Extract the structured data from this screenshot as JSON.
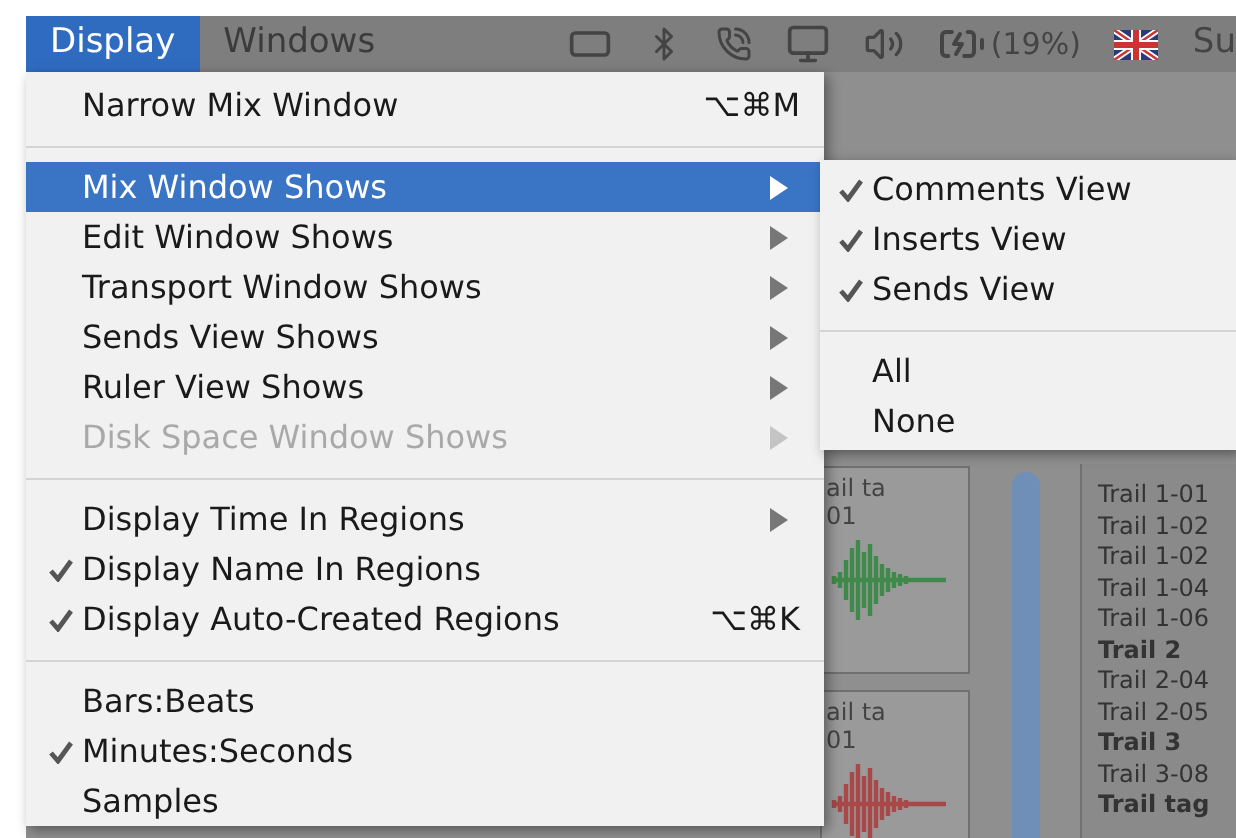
{
  "menu_bar": {
    "items": [
      {
        "label": "Display",
        "selected": true
      },
      {
        "label": "Windows",
        "selected": false
      }
    ],
    "battery": "(19%)",
    "clock": "Su"
  },
  "menu": {
    "items": [
      {
        "kind": "item",
        "label": "Narrow Mix Window",
        "shortcut": "⌥⌘M",
        "checked": false,
        "submenu": false,
        "disabled": false,
        "selected": false
      },
      {
        "kind": "separator"
      },
      {
        "kind": "item",
        "label": "Mix Window Shows",
        "checked": false,
        "submenu": true,
        "disabled": false,
        "selected": true
      },
      {
        "kind": "item",
        "label": "Edit Window Shows",
        "checked": false,
        "submenu": true,
        "disabled": false,
        "selected": false
      },
      {
        "kind": "item",
        "label": "Transport Window Shows",
        "checked": false,
        "submenu": true,
        "disabled": false,
        "selected": false
      },
      {
        "kind": "item",
        "label": "Sends View Shows",
        "checked": false,
        "submenu": true,
        "disabled": false,
        "selected": false
      },
      {
        "kind": "item",
        "label": "Ruler View Shows",
        "checked": false,
        "submenu": true,
        "disabled": false,
        "selected": false
      },
      {
        "kind": "item",
        "label": "Disk Space Window Shows",
        "checked": false,
        "submenu": true,
        "disabled": true,
        "selected": false
      },
      {
        "kind": "separator"
      },
      {
        "kind": "item",
        "label": "Display Time In Regions",
        "checked": false,
        "submenu": true,
        "disabled": false,
        "selected": false
      },
      {
        "kind": "item",
        "label": "Display Name In Regions",
        "checked": true,
        "submenu": false,
        "disabled": false,
        "selected": false
      },
      {
        "kind": "item",
        "label": "Display Auto-Created Regions",
        "shortcut": "⌥⌘K",
        "checked": true,
        "submenu": false,
        "disabled": false,
        "selected": false
      },
      {
        "kind": "separator"
      },
      {
        "kind": "item",
        "label": "Bars:Beats",
        "checked": false,
        "submenu": false,
        "disabled": false,
        "selected": false
      },
      {
        "kind": "item",
        "label": "Minutes:Seconds",
        "checked": true,
        "submenu": false,
        "disabled": false,
        "selected": false
      },
      {
        "kind": "item",
        "label": "Samples",
        "checked": false,
        "submenu": false,
        "disabled": false,
        "selected": false
      }
    ]
  },
  "submenu": {
    "items": [
      {
        "kind": "item",
        "label": "Comments View",
        "checked": true
      },
      {
        "kind": "item",
        "label": "Inserts View",
        "checked": true
      },
      {
        "kind": "item",
        "label": "Sends View",
        "checked": true
      },
      {
        "kind": "separator"
      },
      {
        "kind": "item",
        "label": "All",
        "checked": false
      },
      {
        "kind": "item",
        "label": "None",
        "checked": false
      }
    ]
  },
  "background": {
    "regions": [
      {
        "label": "ail ta",
        "number": "01",
        "color": "#3f8a4a"
      },
      {
        "label": "ail ta",
        "number": "01",
        "color": "#a84848"
      }
    ],
    "tracks": [
      {
        "label": "Trail 1-01",
        "bold": false
      },
      {
        "label": "Trail 1-02",
        "bold": false
      },
      {
        "label": "Trail 1-02",
        "bold": false
      },
      {
        "label": "Trail 1-04",
        "bold": false
      },
      {
        "label": "Trail 1-06",
        "bold": false
      },
      {
        "label": "Trail 2",
        "bold": true
      },
      {
        "label": "Trail 2-04",
        "bold": false
      },
      {
        "label": "Trail 2-05",
        "bold": false
      },
      {
        "label": "Trail 3",
        "bold": true
      },
      {
        "label": "Trail 3-08",
        "bold": false
      },
      {
        "label": "Trail tag",
        "bold": true
      }
    ]
  }
}
